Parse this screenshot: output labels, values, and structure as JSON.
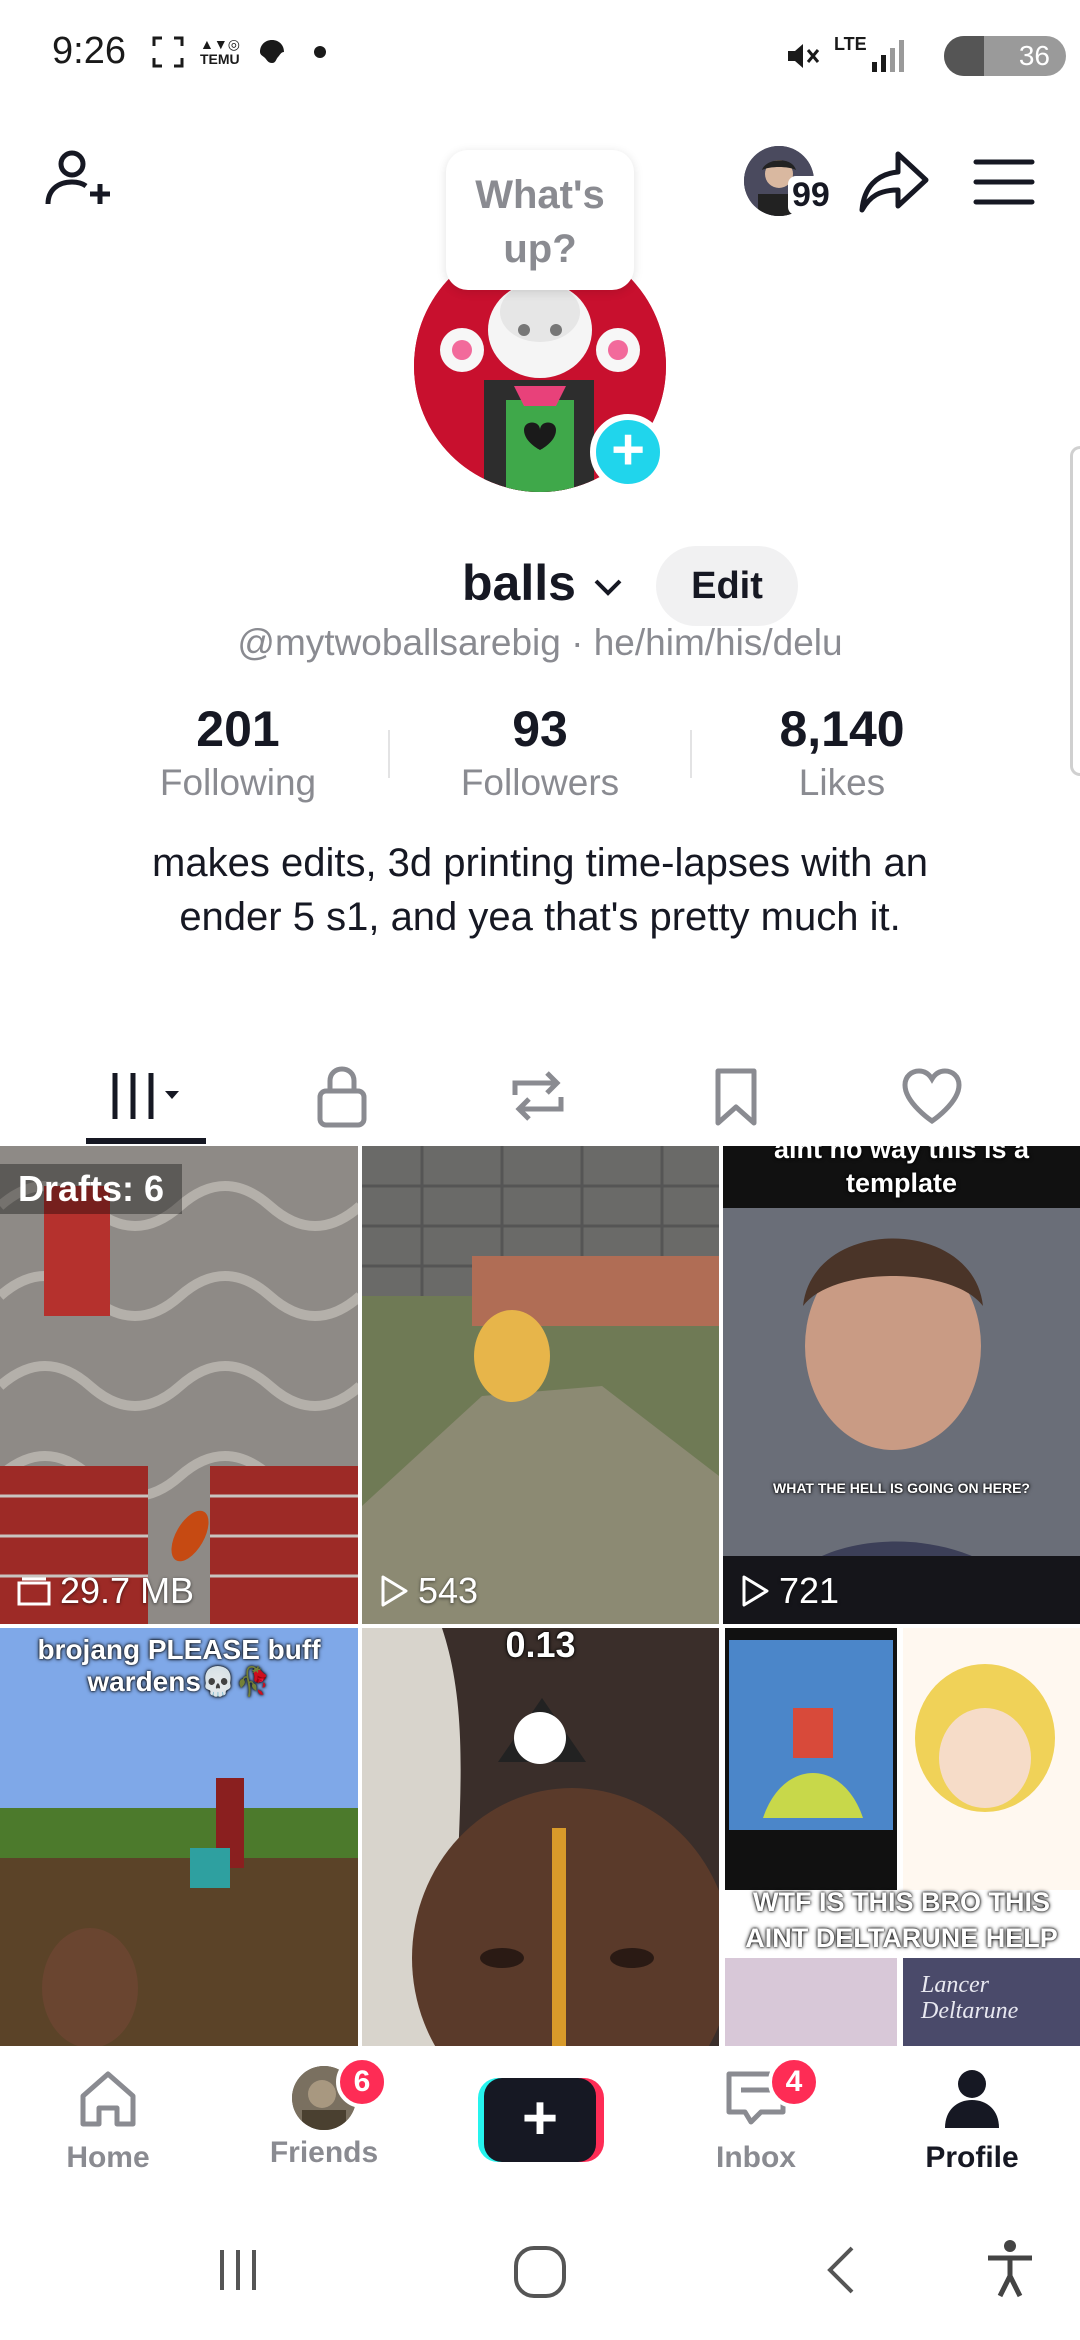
{
  "status_bar": {
    "time": "9:26",
    "battery": "36",
    "network": "LTE"
  },
  "header": {
    "whats_up": "What's up?",
    "friends_count": "99"
  },
  "profile": {
    "display_name": "balls",
    "edit_label": "Edit",
    "handle_line": "@mytwoballsarebig · he/him/his/delu",
    "stats": [
      {
        "value": "201",
        "label": "Following"
      },
      {
        "value": "93",
        "label": "Followers"
      },
      {
        "value": "8,140",
        "label": "Likes"
      }
    ],
    "bio": "makes edits, 3d printing time-lapses with an ender 5 s1, and yea that's pretty much it."
  },
  "tabs": [
    "videos-grid-icon",
    "lock-icon",
    "repost-icon",
    "bookmark-icon",
    "heart-icon"
  ],
  "grid": {
    "drafts_label": "Drafts: 6",
    "drafts_size": "29.7 MB",
    "video2_views": "543",
    "video3_caption_top": "aint no way this is a template",
    "video3_inner_caption": "WHAT THE HELL IS GOING ON HERE?",
    "video3_views": "721",
    "video4_caption": "brojang PLEASE buff wardens💀🥀",
    "video5_caption": "0.13",
    "video6_caption": "WTF IS THIS BRO THIS AINT DELTARUNE HELP",
    "video6_inner_text": "Lancer Deltarune"
  },
  "bottom_nav": {
    "home": "Home",
    "friends": "Friends",
    "friends_badge": "6",
    "inbox": "Inbox",
    "inbox_badge": "4",
    "profile": "Profile"
  },
  "colors": {
    "accent_red": "#fe2c55",
    "accent_cyan": "#20d5ec",
    "text_primary": "#161823",
    "text_secondary": "#8a8b91"
  }
}
